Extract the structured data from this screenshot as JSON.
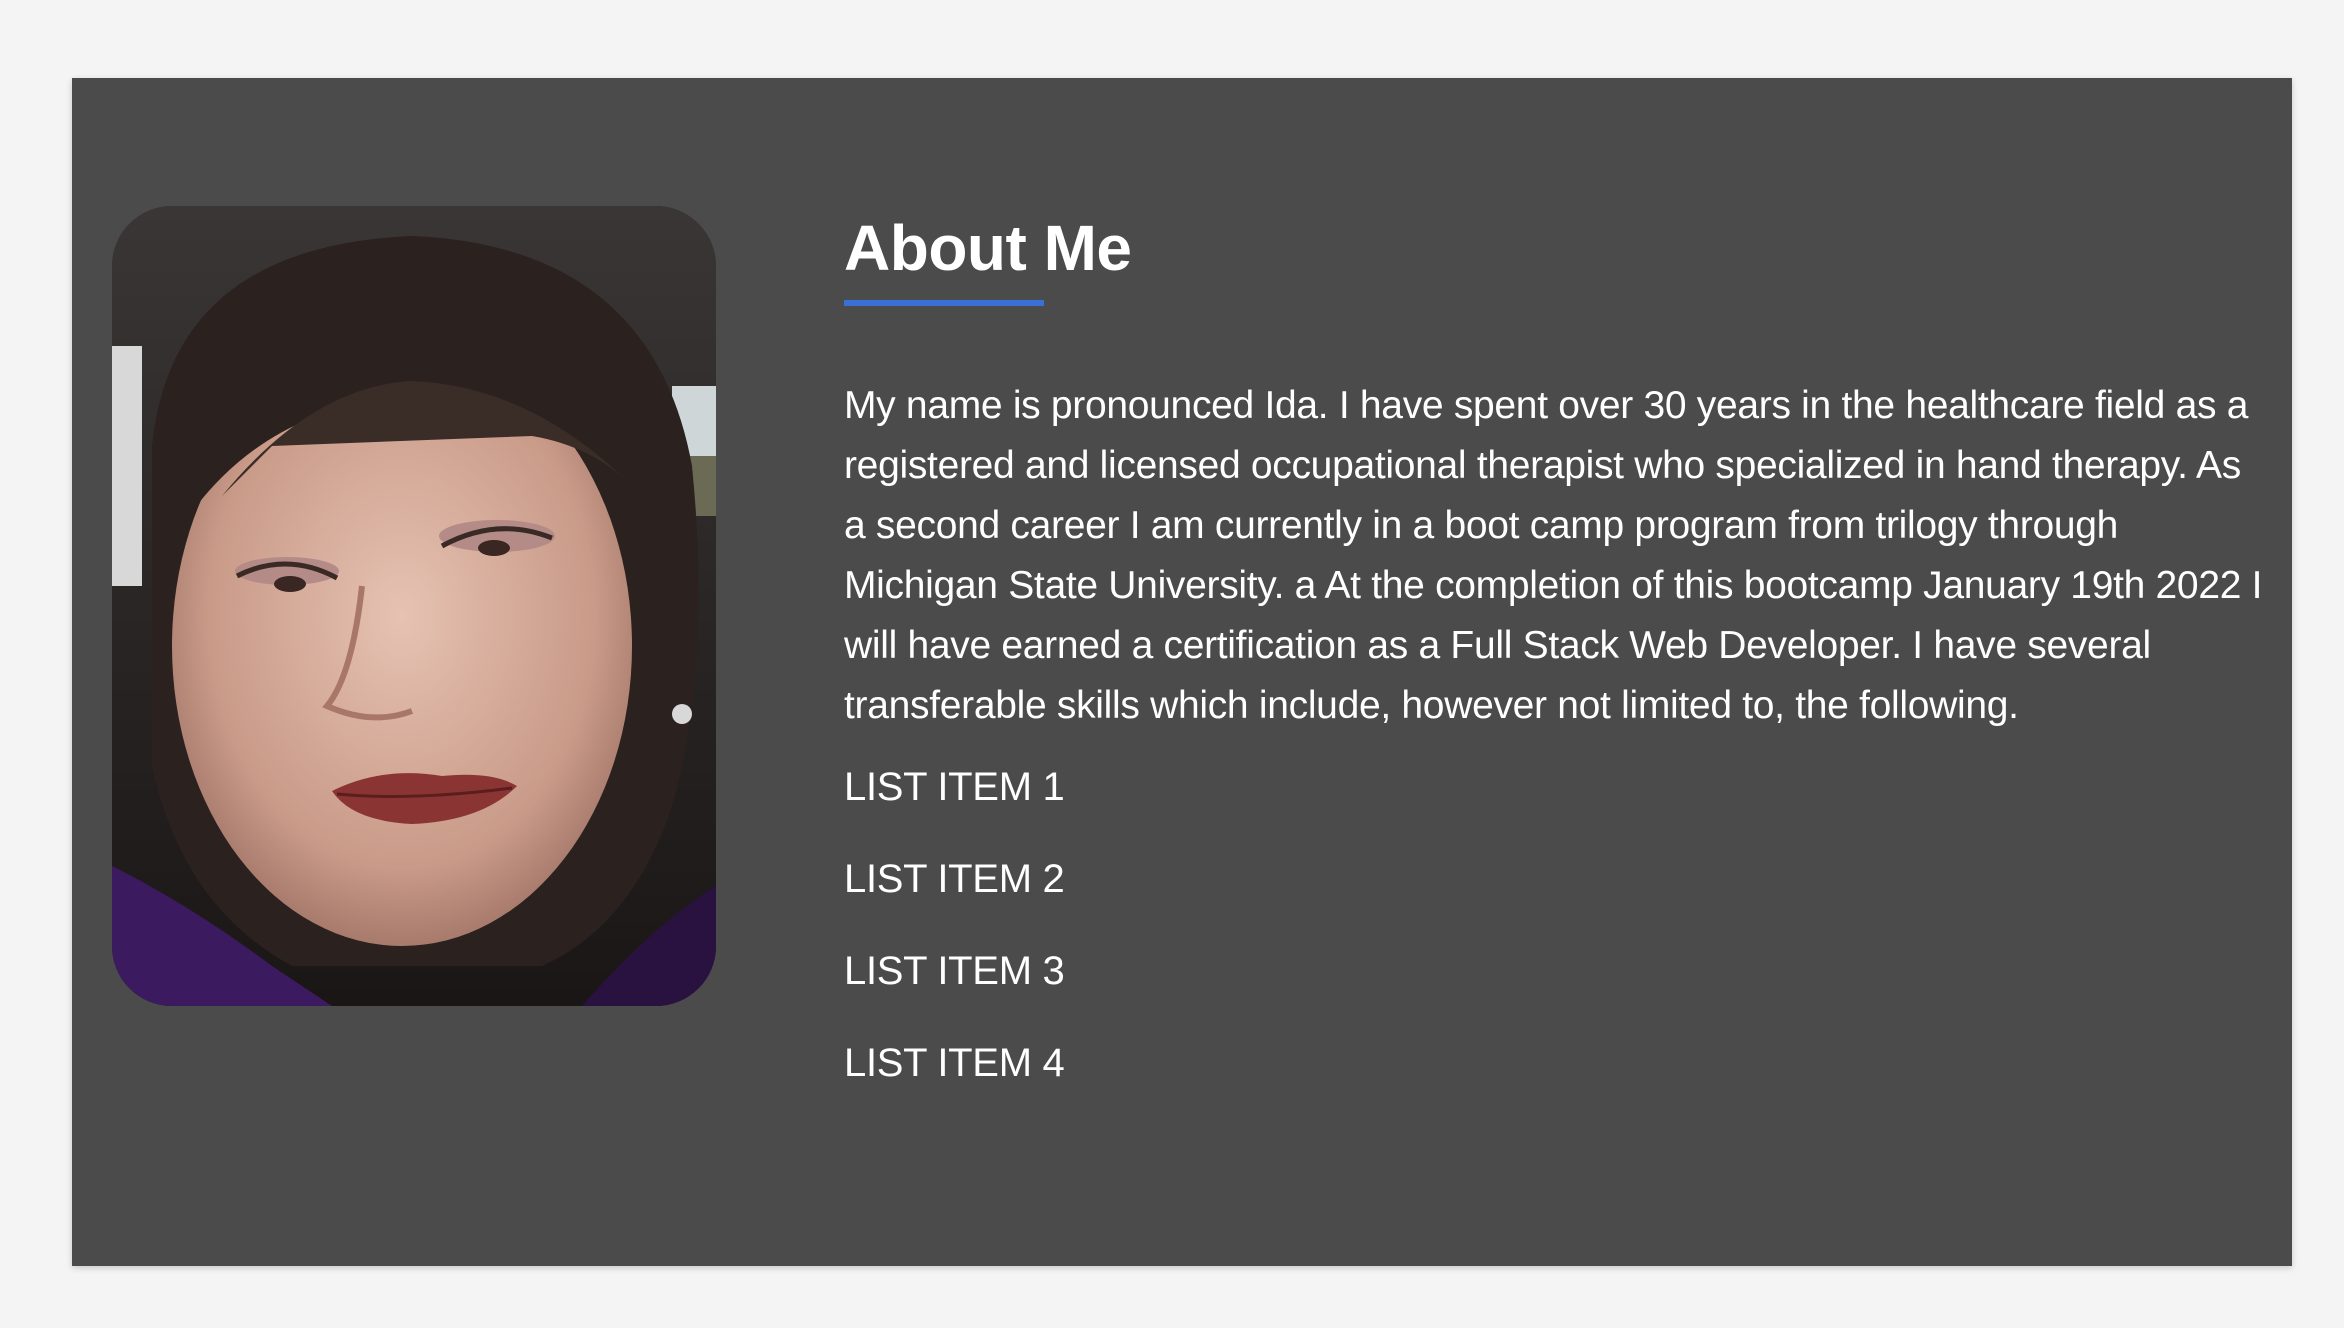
{
  "about": {
    "title": "About Me",
    "accent_color": "#3b6fd8",
    "photo_icon": "profile-photo",
    "bio": "My name is pronounced Ida. I have spent over 30 years in the healthcare field as a registered and licensed occupational therapist who specialized in hand therapy. As a second career I am currently in a boot camp program from trilogy through Michigan State University. a At the completion of this bootcamp January 19th 2022 I will have earned a certification as a Full Stack Web Developer. I have several transferable skills which include, however not limited to, the following.",
    "list_items": [
      "LIST ITEM 1",
      "LIST ITEM 2",
      "LIST ITEM 3",
      "LIST ITEM 4"
    ]
  }
}
